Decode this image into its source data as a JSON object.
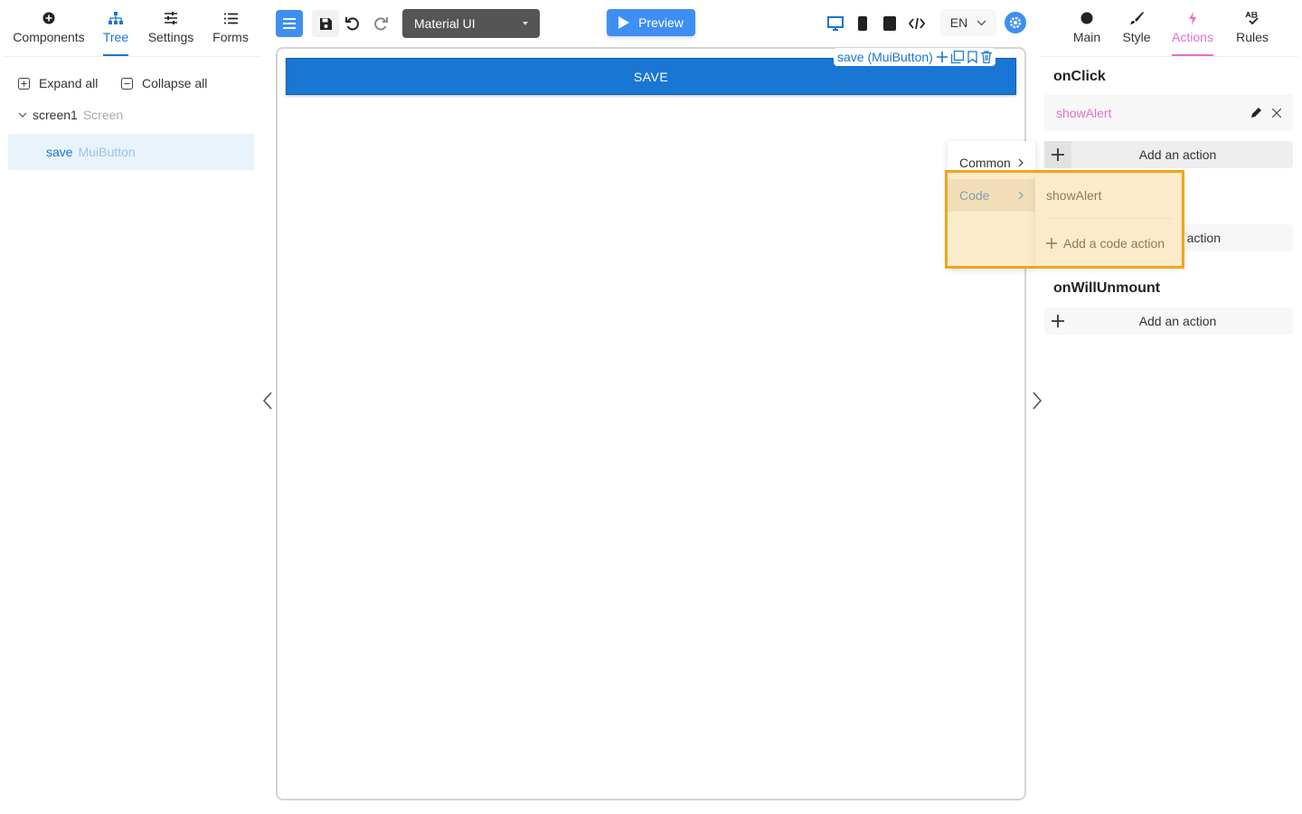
{
  "left_panel": {
    "tabs": [
      {
        "label": "Components",
        "icon": "plus-circle-icon"
      },
      {
        "label": "Tree",
        "icon": "tree-icon",
        "active": true
      },
      {
        "label": "Settings",
        "icon": "sliders-icon"
      },
      {
        "label": "Forms",
        "icon": "list-icon"
      }
    ],
    "expand_all": "Expand all",
    "collapse_all": "Collapse all",
    "tree": {
      "root_name": "screen1",
      "root_type": "Screen",
      "child_name": "save",
      "child_type": "MuiButton"
    }
  },
  "toolbar": {
    "library": "Material UI",
    "preview": "Preview",
    "language": "EN",
    "accent": "#3f8ff2"
  },
  "canvas": {
    "button_label": "SAVE",
    "selection_label": "save (MuiButton)",
    "button_color": "#1976d2"
  },
  "right_panel": {
    "tabs": [
      {
        "label": "Main",
        "icon": "circle-icon"
      },
      {
        "label": "Style",
        "icon": "brush-icon"
      },
      {
        "label": "Actions",
        "icon": "lightning-icon",
        "active": true
      },
      {
        "label": "Rules",
        "icon": "spellcheck-icon"
      }
    ],
    "onclick_title": "onClick",
    "existing_action": "showAlert",
    "add_action_label": "Add an action",
    "hidden_add_action_fragment": "action",
    "onwillunmount_title": "onWillUnmount",
    "accent": "#e46fd1"
  },
  "dropdown": {
    "level1": [
      "Common",
      "Code"
    ],
    "level2": [
      "showAlert",
      "Add a code action"
    ],
    "highlight_color": "#f2a419"
  }
}
